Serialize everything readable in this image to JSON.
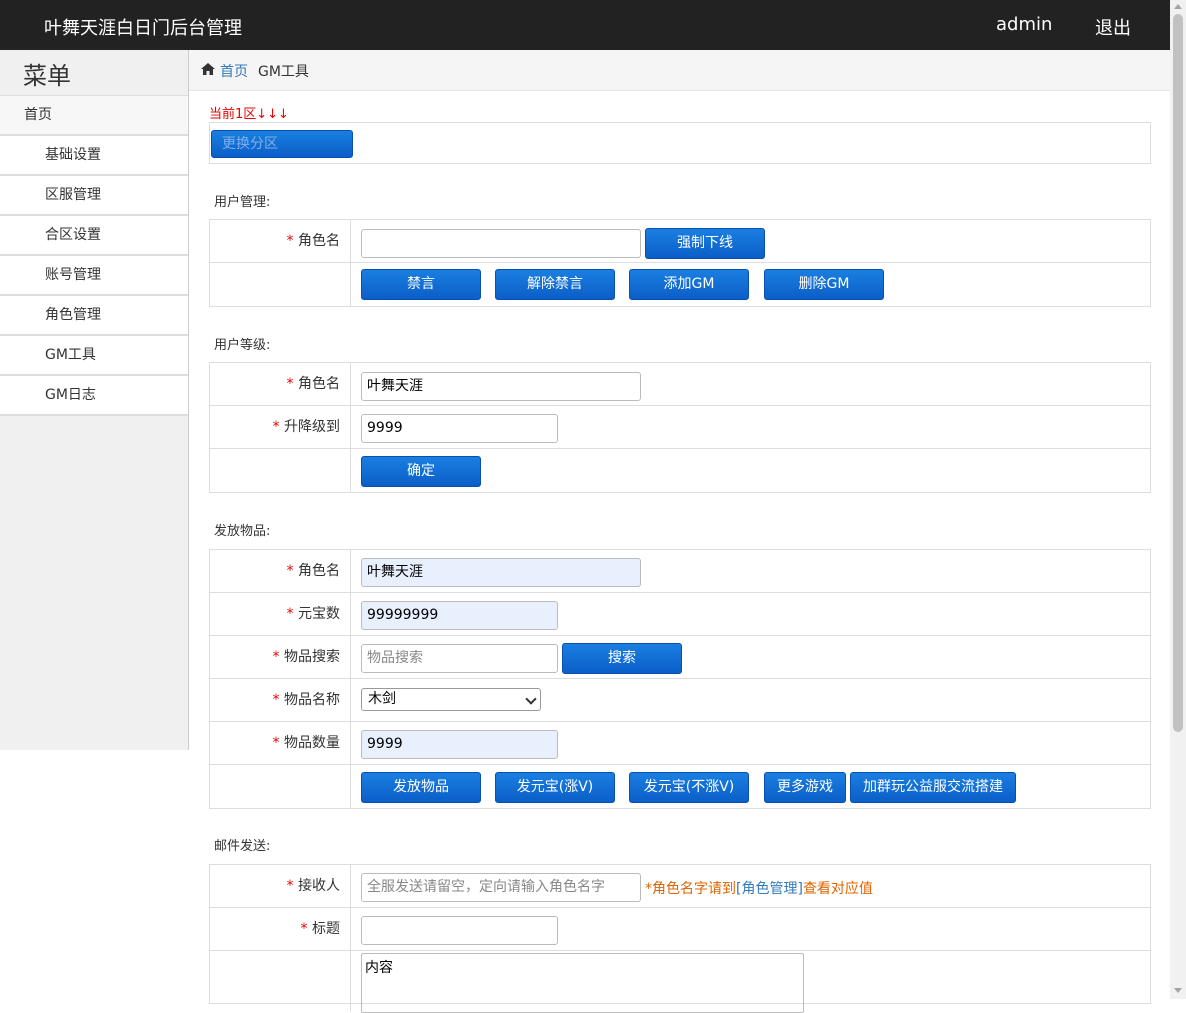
{
  "header": {
    "title": "叶舞天涯白日门后台管理",
    "user": "admin",
    "logout": "退出"
  },
  "sidebar": {
    "title": "菜单",
    "home": "首页",
    "items": [
      "基础设置",
      "区服管理",
      "合区设置",
      "账号管理",
      "角色管理",
      "GM工具",
      "GM日志"
    ]
  },
  "breadcrumb": {
    "home": "首页",
    "current": "GM工具"
  },
  "zone": {
    "label": "当前1区↓↓↓",
    "change_button": "更换分区"
  },
  "user_manage": {
    "title": "用户管理:",
    "role_label": "角色名",
    "role_value": "",
    "kick_button": "强制下线",
    "buttons": [
      "禁言",
      "解除禁言",
      "添加GM",
      "删除GM"
    ]
  },
  "user_level": {
    "title": "用户等级:",
    "role_label": "角色名",
    "role_value": "叶舞天涯",
    "level_label": "升降级到",
    "level_value": "9999",
    "confirm_button": "确定"
  },
  "items_send": {
    "title": "发放物品:",
    "role_label": "角色名",
    "role_value": "叶舞天涯",
    "gold_label": "元宝数",
    "gold_value": "99999999",
    "search_label": "物品搜索",
    "search_placeholder": "物品搜索",
    "search_button": "搜索",
    "name_label": "物品名称",
    "name_value": "木剑",
    "qty_label": "物品数量",
    "qty_value": "9999",
    "buttons": [
      "发放物品",
      "发元宝(涨V)",
      "发元宝(不涨V)",
      "更多游戏",
      "加群玩公益服交流搭建"
    ]
  },
  "mail": {
    "title": "邮件发送:",
    "receiver_label": "接收人",
    "receiver_placeholder": "全服发送请留空，定向请输入角色名字",
    "hint_prefix": "*角色名字请到",
    "hint_link": "[角色管理]",
    "hint_suffix": "查看对应值",
    "subject_label": "标题",
    "subject_value": "",
    "content_value": "内容"
  },
  "required_mark": "*",
  "icons": {
    "home": "home-icon",
    "dropdown": "chevron-down-icon"
  },
  "colors": {
    "header_bg": "#222222",
    "button_blue": "#0b5ec8",
    "required": "#ee0000",
    "hint": "#e06400",
    "link": "#337ab7"
  }
}
